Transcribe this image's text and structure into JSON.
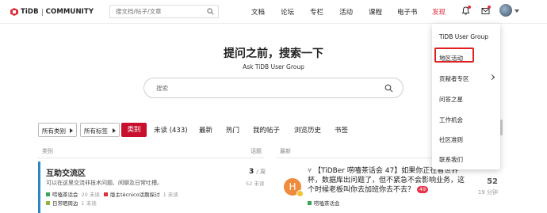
{
  "header": {
    "logo_brand": "TiDB",
    "logo_suffix": "COMMUNITY",
    "search_placeholder": "搜文档/帖子/文章",
    "nav": [
      "文档",
      "论坛",
      "专栏",
      "活动",
      "课程",
      "电子书",
      "发现"
    ],
    "active_nav": "发现",
    "icons": [
      "bell-icon",
      "mail-icon",
      "search-icon"
    ]
  },
  "hero": {
    "title": "提问之前，搜索一下",
    "subtitle": "Ask TiDB User Group",
    "search_placeholder": "搜索"
  },
  "filters": {
    "category_dropdown": "所有类别",
    "tag_dropdown": "所有标签",
    "tabs": [
      "类别",
      "未读 (433)",
      "最新",
      "热门",
      "我的帖子",
      "浏览历史",
      "书签"
    ],
    "active_tab": "类别"
  },
  "categories": {
    "header_left": "类别",
    "header_right": "话题",
    "items": [
      {
        "title": "互助交流区",
        "description": "可以在这里交流非技术问题、闲聊及日常吐槽。",
        "topics": "3",
        "topics_suffix": "/ 周",
        "week_note": "52 未读",
        "color": "#2d87c2",
        "subcategories": [
          {
            "name": "唠嗑茶话会",
            "count": "20 未读",
            "color": "#3aa655"
          },
          {
            "name": "版主técnico话题探讨",
            "count": "1 未读",
            "color": "#e0303a"
          },
          {
            "name": "日常晒周边",
            "count": "1 未读",
            "color": "#8db53c"
          }
        ]
      }
    ]
  },
  "latest": {
    "header": "最新",
    "topics": [
      {
        "avatar_letter": "H",
        "pin": "¥",
        "title": "【TiDBer 唠嗑茶话会 47】如果你正在看世界杯，数据库出问题了，但不紧急不会影响业务，这个时候老板叫你去加班你去不去？",
        "badge": "49",
        "category": "唠嗑茶话会",
        "replies": "52",
        "ago": "19 分钟"
      }
    ]
  },
  "menu": {
    "items": [
      "TiDB User Group",
      "地区活动",
      "贡献者专区",
      "问答之星",
      "工作机会",
      "社区准则",
      "联系我们"
    ],
    "highlighted": "地区活动"
  },
  "colors": {
    "brand_red": "#c8102e",
    "accent_red": "#e0303a",
    "category_blue": "#2d87c2",
    "avatar_orange": "#f08a3c"
  }
}
